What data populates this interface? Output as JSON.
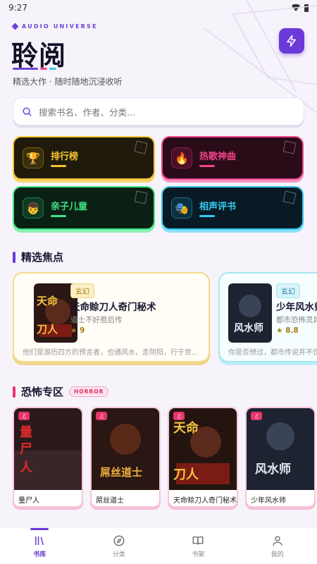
{
  "status": {
    "time": "9:27"
  },
  "header": {
    "brand": "AUDIO UNIVERSE",
    "title": "聆阅",
    "subtitle": "精选大作 · 随时随地沉浸收听",
    "accent": "#6c3ad9"
  },
  "search": {
    "placeholder": "搜索书名、作者、分类..."
  },
  "categories": [
    {
      "label": "排行榜",
      "icon": "trophy-icon",
      "color": "#f6c431"
    },
    {
      "label": "热歌神曲",
      "icon": "fire-icon",
      "color": "#f0448a"
    },
    {
      "label": "亲子儿童",
      "icon": "child-icon",
      "color": "#3ee483"
    },
    {
      "label": "相声评书",
      "icon": "theater-mask-icon",
      "color": "#35c9ef"
    }
  ],
  "featured": {
    "title": "精选焦点",
    "items": [
      {
        "tag": "玄幻",
        "title": "天命赊刀人奇门秘术",
        "author": "道士不好惹后传",
        "rating": "9",
        "desc": "他们是游历四方的预言者，也通风水，走阴阳，行于世..."
      },
      {
        "tag": "玄幻",
        "title": "少年风水师",
        "author": "都市恐怖灵异",
        "rating": "8.8",
        "desc": "你是否想过，都市传说并不仅"
      }
    ]
  },
  "horror": {
    "title": "恐怖专区",
    "badge": "HORROR",
    "items": [
      {
        "label": "量尸人"
      },
      {
        "label": "屌丝道士"
      },
      {
        "label": "天命赊刀人奇门秘术"
      },
      {
        "label": "少年风水师"
      }
    ]
  },
  "nav": [
    {
      "label": "书库",
      "icon": "library-icon",
      "active": true
    },
    {
      "label": "分类",
      "icon": "compass-icon",
      "active": false
    },
    {
      "label": "书架",
      "icon": "book-icon",
      "active": false
    },
    {
      "label": "我的",
      "icon": "user-icon",
      "active": false
    }
  ]
}
